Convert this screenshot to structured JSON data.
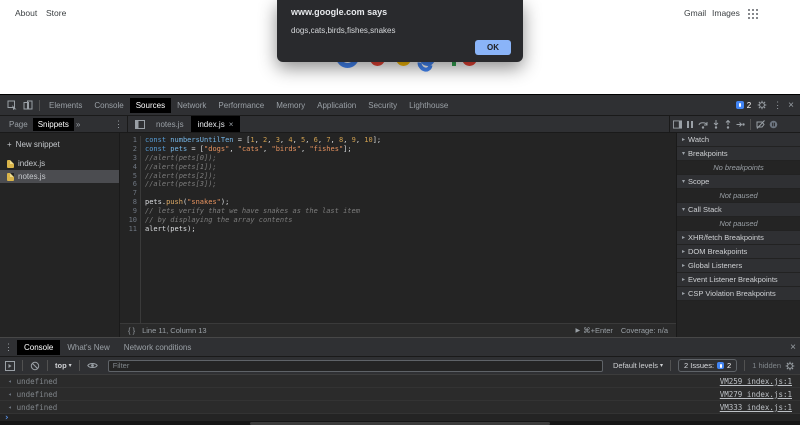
{
  "icons": {
    "expanded": "▾",
    "collapsed": "▸",
    "dropdown": "▾",
    "more_tabs": "»",
    "kebab": "⋮",
    "close": "×",
    "result_arrow": "◂",
    "prompt": "›",
    "run": "▶",
    "pretty_print": "{ }",
    "plus": "+"
  },
  "browser_page": {
    "links_left": [
      "About",
      "Store"
    ],
    "links_right": [
      "Gmail",
      "Images"
    ],
    "logo_colors": [
      "#4285F4",
      "#EA4335",
      "#FBBC05",
      "#4285F4",
      "#4285F4",
      "#34A853",
      "#EA4335"
    ],
    "dialog": {
      "title": "www.google.com says",
      "message": "dogs,cats,birds,fishes,snakes",
      "ok_label": "OK"
    }
  },
  "devtools": {
    "main_tabs": [
      "Elements",
      "Console",
      "Sources",
      "Network",
      "Performance",
      "Memory",
      "Application",
      "Security",
      "Lighthouse"
    ],
    "active_main_tab": "Sources",
    "issues_count": "2",
    "navigator": {
      "tabs": [
        "Page",
        "Snippets"
      ],
      "active_tab": "Snippets",
      "new_snippet_label": "New snippet",
      "files": [
        {
          "name": "index.js",
          "selected": false
        },
        {
          "name": "notes.js",
          "selected": true
        }
      ]
    },
    "editor": {
      "tabs": [
        {
          "label": "notes.js",
          "active": false,
          "closable": false
        },
        {
          "label": "index.js",
          "active": true,
          "closable": true
        }
      ],
      "code_lines": [
        [
          [
            "k",
            "const"
          ],
          [
            "p",
            " "
          ],
          [
            "v",
            "numbersUntilTen"
          ],
          [
            "p",
            " = ["
          ],
          [
            "n",
            "1"
          ],
          [
            "p",
            ", "
          ],
          [
            "n",
            "2"
          ],
          [
            "p",
            ", "
          ],
          [
            "n",
            "3"
          ],
          [
            "p",
            ", "
          ],
          [
            "n",
            "4"
          ],
          [
            "p",
            ", "
          ],
          [
            "n",
            "5"
          ],
          [
            "p",
            ", "
          ],
          [
            "n",
            "6"
          ],
          [
            "p",
            ", "
          ],
          [
            "n",
            "7"
          ],
          [
            "p",
            ", "
          ],
          [
            "n",
            "8"
          ],
          [
            "p",
            ", "
          ],
          [
            "n",
            "9"
          ],
          [
            "p",
            ", "
          ],
          [
            "n",
            "10"
          ],
          [
            "p",
            "];"
          ]
        ],
        [
          [
            "k",
            "const"
          ],
          [
            "p",
            " "
          ],
          [
            "v",
            "pets"
          ],
          [
            "p",
            " = ["
          ],
          [
            "s",
            "\"dogs\""
          ],
          [
            "p",
            ", "
          ],
          [
            "s",
            "\"cats\""
          ],
          [
            "p",
            ", "
          ],
          [
            "s",
            "\"birds\""
          ],
          [
            "p",
            ", "
          ],
          [
            "s",
            "\"fishes\""
          ],
          [
            "p",
            "];"
          ]
        ],
        [
          [
            "c",
            "//alert(pets[0]);"
          ]
        ],
        [
          [
            "c",
            "//alert(pets[1]);"
          ]
        ],
        [
          [
            "c",
            "//alert(pets[2]);"
          ]
        ],
        [
          [
            "c",
            "//alert(pets[3]);"
          ]
        ],
        [],
        [
          [
            "p",
            "pets."
          ],
          [
            "m",
            "push"
          ],
          [
            "p",
            "("
          ],
          [
            "s",
            "\"snakes\""
          ],
          [
            "p",
            ");"
          ]
        ],
        [
          [
            "c",
            "// lets verify that we have snakes as the last item"
          ]
        ],
        [
          [
            "c",
            "// by displaying the array contents"
          ]
        ],
        [
          [
            "p",
            "alert(pets);"
          ]
        ]
      ],
      "status_bar": {
        "location": "Line 11, Column 13",
        "run_shortcut": "⌘+Enter",
        "coverage": "Coverage: n/a"
      }
    },
    "debugger_panel": {
      "sections": [
        {
          "label": "Watch",
          "expanded": false
        },
        {
          "label": "Breakpoints",
          "expanded": true,
          "content": "No breakpoints"
        },
        {
          "label": "Scope",
          "expanded": true,
          "content": "Not paused"
        },
        {
          "label": "Call Stack",
          "expanded": true,
          "content": "Not paused"
        },
        {
          "label": "XHR/fetch Breakpoints",
          "expanded": false
        },
        {
          "label": "DOM Breakpoints",
          "expanded": false
        },
        {
          "label": "Global Listeners",
          "expanded": false
        },
        {
          "label": "Event Listener Breakpoints",
          "expanded": false
        },
        {
          "label": "CSP Violation Breakpoints",
          "expanded": false
        }
      ]
    },
    "drawer": {
      "tabs": [
        "Console",
        "What's New",
        "Network conditions"
      ],
      "active_tab": "Console",
      "toolbar": {
        "context": "top",
        "filter_placeholder": "Filter",
        "levels_label": "Default levels",
        "issues_label": "2 Issues:",
        "issues_count": "2",
        "hidden_label": "1 hidden"
      },
      "messages": [
        {
          "text": "undefined",
          "location": "VM259 index.js:1"
        },
        {
          "text": "undefined",
          "location": "VM279 index.js:1"
        },
        {
          "text": "undefined",
          "location": "VM333 index.js:1"
        }
      ]
    }
  }
}
